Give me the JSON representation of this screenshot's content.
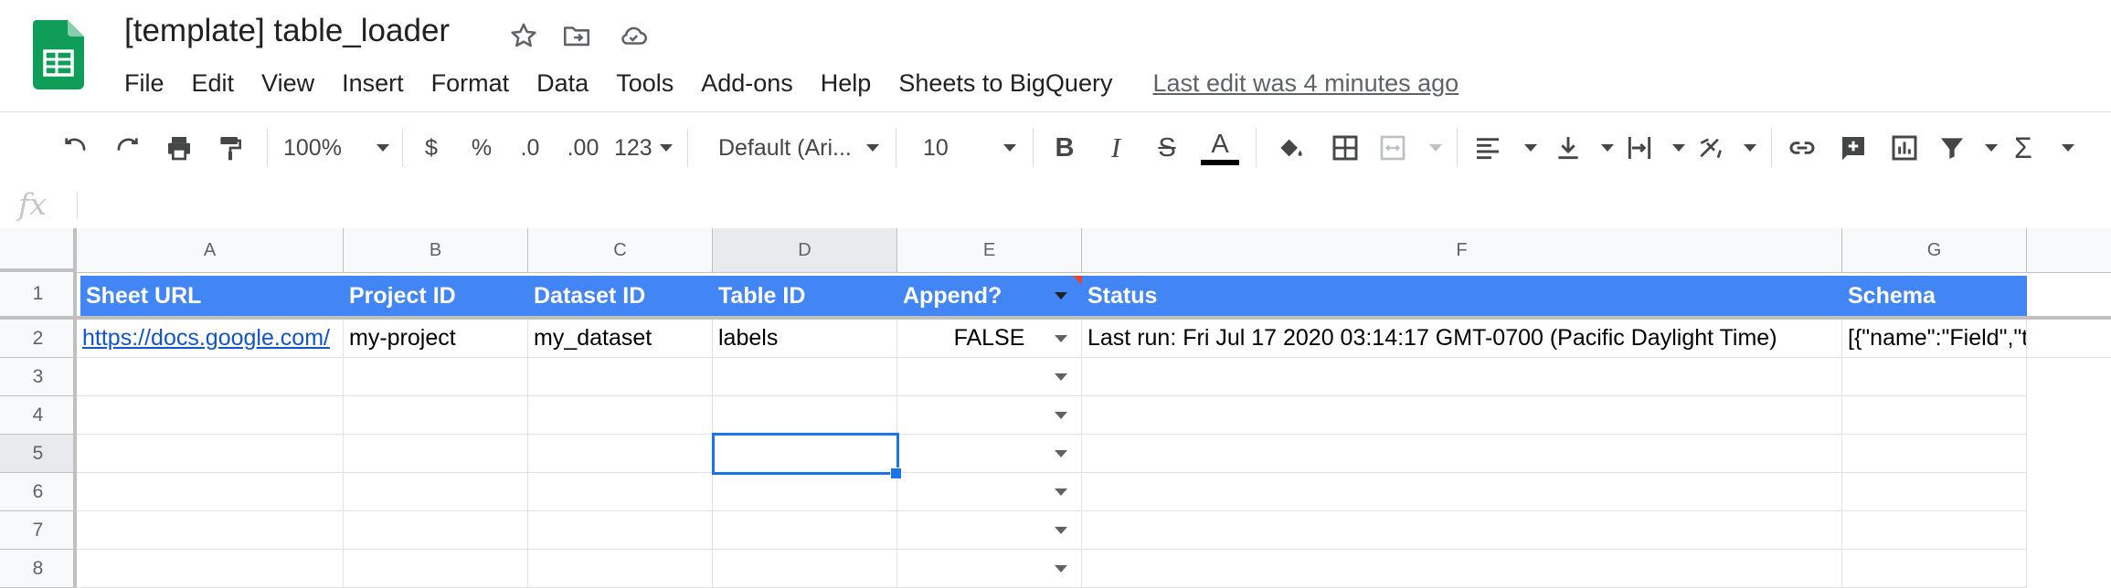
{
  "app": {
    "title": "[template] table_loader",
    "brand_color": "#0f9d58",
    "title_icons": [
      "star-icon",
      "move-to-folder-icon",
      "cloud-saved-icon"
    ]
  },
  "menu": {
    "items": [
      "File",
      "Edit",
      "View",
      "Insert",
      "Format",
      "Data",
      "Tools",
      "Add-ons",
      "Help",
      "Sheets to BigQuery"
    ],
    "last_edit": "Last edit was 4 minutes ago"
  },
  "toolbar": {
    "zoom": "100%",
    "currency": "$",
    "percent": "%",
    "decrease_decimal": ".0",
    "increase_decimal": ".00",
    "more_formats": "123",
    "font": "Default (Ari...",
    "font_size": "10",
    "bold": "B",
    "italic": "I",
    "strikethrough": "S",
    "text_color": "A"
  },
  "formula_bar": {
    "fx": "fx",
    "value": ""
  },
  "grid": {
    "columns": [
      "A",
      "B",
      "C",
      "D",
      "E",
      "F",
      "G"
    ],
    "rows": [
      "1",
      "2",
      "3",
      "4",
      "5",
      "6",
      "7",
      "8"
    ],
    "header_row": [
      "Sheet URL",
      "Project ID",
      "Dataset ID",
      "Table ID",
      "Append?",
      "Status",
      "Schema"
    ],
    "data_row": {
      "sheet_url": "https://docs.google.com/",
      "project_id": "my-project",
      "dataset_id": "my_dataset",
      "table_id": "labels",
      "append": "FALSE",
      "status": "Last run: Fri Jul 17 2020 03:14:17 GMT-0700 (Pacific Daylight Time)",
      "schema": "[{\"name\":\"Field\",\"type\":\"D"
    },
    "header_color": "#4285f4",
    "selected_cell": "D5",
    "selection_color": "#1a73e8"
  }
}
